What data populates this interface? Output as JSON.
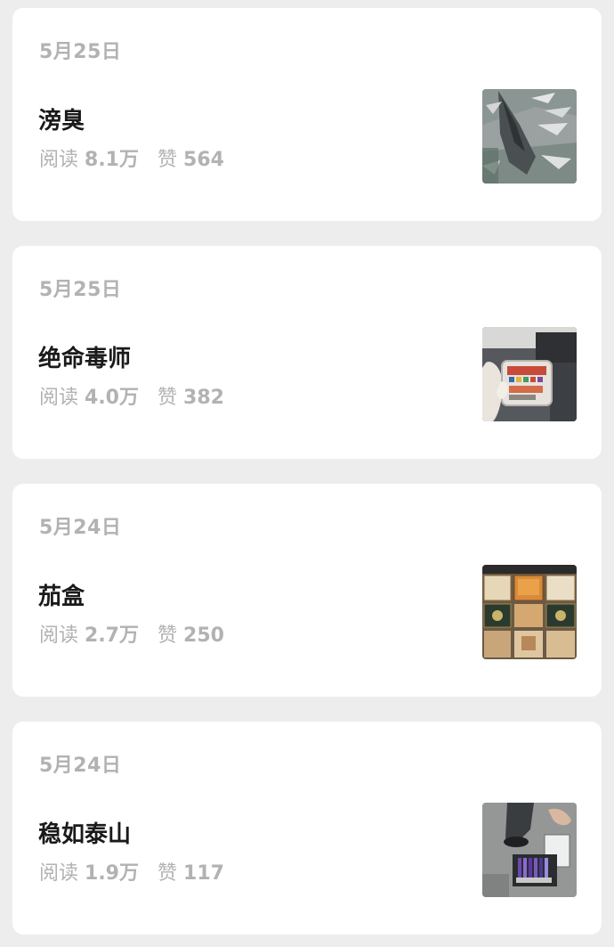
{
  "articles": [
    {
      "date": "5月25日",
      "title": "滂臭",
      "read_label": "阅读",
      "read_count": "8.1万",
      "like_label": "赞",
      "like_count": "564",
      "thumb_icon": "shark-fins-photo"
    },
    {
      "date": "5月25日",
      "title": "绝命毒师",
      "read_label": "阅读",
      "read_count": "4.0万",
      "like_label": "赞",
      "like_count": "382",
      "thumb_icon": "gloved-hand-container-photo"
    },
    {
      "date": "5月24日",
      "title": "茄盒",
      "read_label": "阅读",
      "read_count": "2.7万",
      "like_label": "赞",
      "like_count": "250",
      "thumb_icon": "cigar-boxes-photo"
    },
    {
      "date": "5月24日",
      "title": "稳如泰山",
      "read_label": "阅读",
      "read_count": "1.9万",
      "like_label": "赞",
      "like_count": "117",
      "thumb_icon": "luggage-inspection-photo"
    }
  ],
  "colors": {
    "background": "#ededed",
    "card": "#ffffff",
    "title": "#1a1a1a",
    "meta": "#b2b2b2"
  }
}
